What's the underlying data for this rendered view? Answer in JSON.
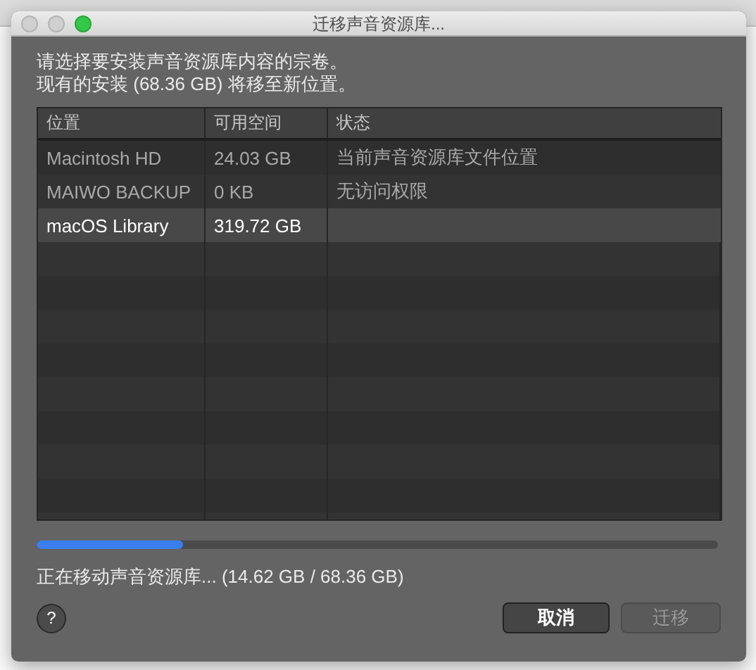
{
  "window": {
    "title": "迁移声音资源库..."
  },
  "instructions": [
    "请选择要安装声音资源库内容的宗卷。",
    "现有的安装 (68.36 GB) 将移至新位置。"
  ],
  "table": {
    "columns": [
      "位置",
      "可用空间",
      "状态"
    ],
    "rows": [
      {
        "cells": [
          "Macintosh HD",
          "24.03 GB",
          "当前声音资源库文件位置"
        ],
        "enabled": false,
        "selected": false
      },
      {
        "cells": [
          "MAIWO BACKUP",
          "0 KB",
          "无访问权限"
        ],
        "enabled": false,
        "selected": false
      },
      {
        "cells": [
          "macOS Library",
          "319.72 GB",
          ""
        ],
        "enabled": true,
        "selected": true
      }
    ]
  },
  "progress": {
    "level": 0.214
  },
  "status": "正在移动声音资源库... (14.62 GB / 68.36 GB)",
  "buttons": [
    {
      "kind": "help",
      "label": "?"
    },
    {
      "kind": "cancel",
      "label": "取消",
      "disabled": false
    },
    {
      "kind": "migrate",
      "label": "迁移",
      "disabled": true
    }
  ]
}
